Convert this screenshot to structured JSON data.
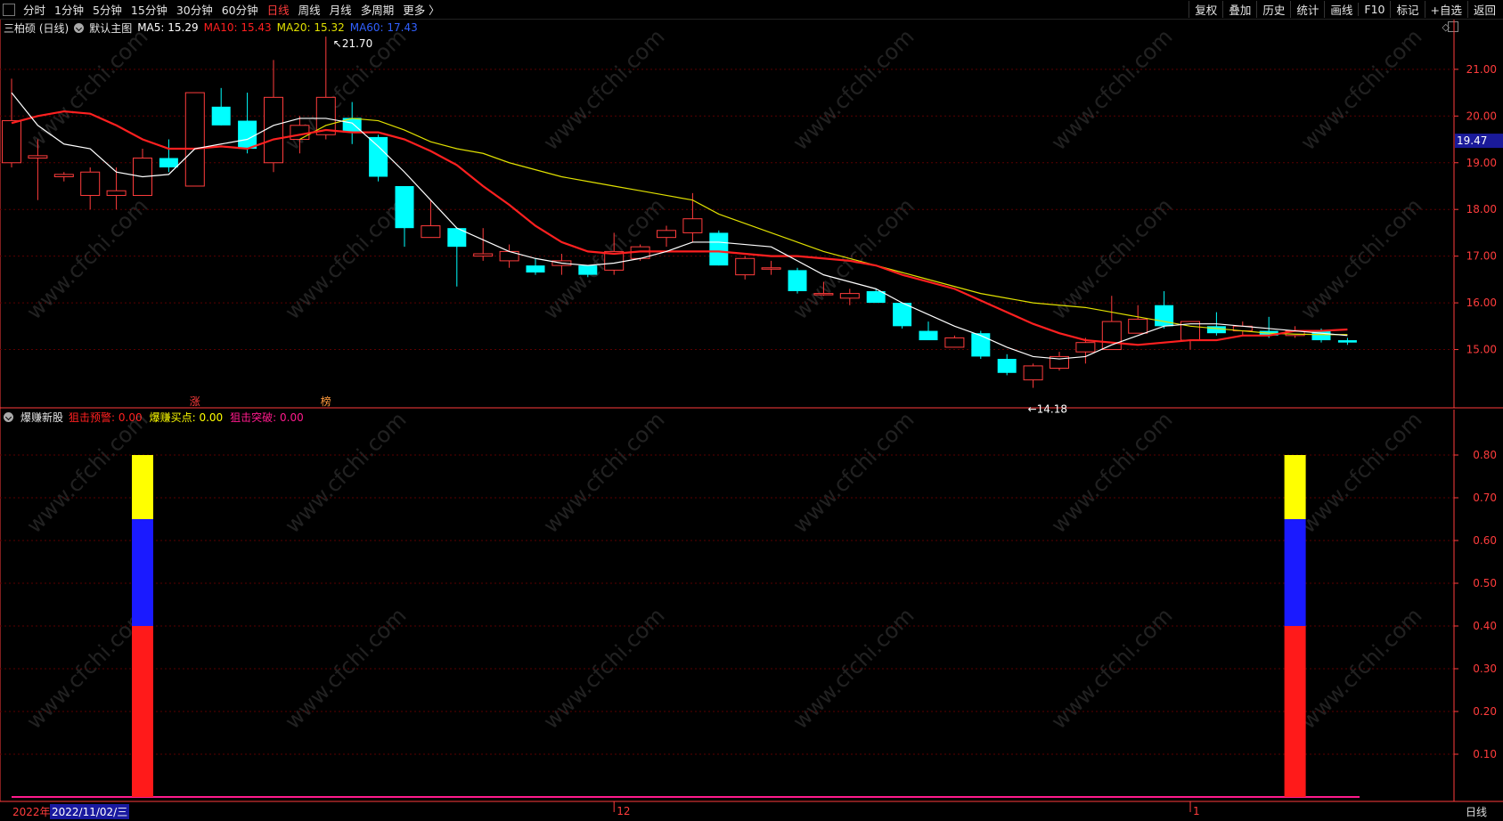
{
  "toolbar": {
    "periods": [
      "分时",
      "1分钟",
      "5分钟",
      "15分钟",
      "30分钟",
      "60分钟",
      "日线",
      "周线",
      "月线",
      "多周期",
      "更多 〉"
    ],
    "active_period": "日线",
    "actions": [
      "复权",
      "叠加",
      "历史",
      "统计",
      "画线",
      "F10",
      "标记",
      "+自选",
      "返回"
    ]
  },
  "legend": {
    "stock": "三柏硕 (日线)",
    "main_chart": "默认主图",
    "ma5": "MA5: 15.29",
    "ma10": "MA10: 15.43",
    "ma20": "MA20: 15.32",
    "ma60": "MA60: 17.43"
  },
  "indicator_legend": {
    "name": "爆赚新股",
    "a": "狙击预警: 0.00",
    "b": "爆赚买点: 0.00",
    "c": "狙击突破: 0.00"
  },
  "colors": {
    "up": "#ff3c3c",
    "down": "#00ffff",
    "ma5": "#ffffff",
    "ma10": "#ff2020",
    "ma20": "#e0e000",
    "ma60": "#3060ff",
    "grid": "#5a0000",
    "axis": "#ff3c3c"
  },
  "chart_data": [
    {
      "type": "candlestick",
      "title": "三柏硕 (日线)",
      "ylim": [
        14.0,
        21.7
      ],
      "yticks": [
        15.0,
        16.0,
        17.0,
        18.0,
        19.0,
        20.0,
        21.0
      ],
      "ytick_labels": [
        "15.00",
        "16.00",
        "17.00",
        "18.00",
        "19.00",
        "20.00",
        "21.00"
      ],
      "current_price_tag": "19.47",
      "high_annotation": "21.70",
      "low_annotation": "14.18",
      "markers": [
        {
          "text": "涨",
          "index": 7
        },
        {
          "text": "榜",
          "index": 12
        }
      ],
      "candles": [
        {
          "o": 19.0,
          "h": 20.8,
          "l": 18.9,
          "c": 19.9
        },
        {
          "o": 19.1,
          "h": 19.5,
          "l": 18.2,
          "c": 19.15
        },
        {
          "o": 18.7,
          "h": 18.8,
          "l": 18.6,
          "c": 18.75
        },
        {
          "o": 18.3,
          "h": 18.9,
          "l": 18.0,
          "c": 18.8
        },
        {
          "o": 18.3,
          "h": 18.9,
          "l": 18.0,
          "c": 18.4
        },
        {
          "o": 18.3,
          "h": 19.3,
          "l": 18.3,
          "c": 19.1
        },
        {
          "o": 19.1,
          "h": 19.5,
          "l": 18.8,
          "c": 18.9
        },
        {
          "o": 18.5,
          "h": 20.5,
          "l": 18.5,
          "c": 20.5
        },
        {
          "o": 20.2,
          "h": 20.6,
          "l": 19.8,
          "c": 19.8
        },
        {
          "o": 19.9,
          "h": 20.5,
          "l": 19.2,
          "c": 19.3
        },
        {
          "o": 19.0,
          "h": 21.2,
          "l": 18.8,
          "c": 20.4
        },
        {
          "o": 19.5,
          "h": 20.0,
          "l": 19.2,
          "c": 19.8
        },
        {
          "o": 19.6,
          "h": 21.7,
          "l": 19.5,
          "c": 20.4
        },
        {
          "o": 19.96,
          "h": 20.3,
          "l": 19.4,
          "c": 19.65
        },
        {
          "o": 19.55,
          "h": 19.6,
          "l": 18.6,
          "c": 18.7
        },
        {
          "o": 18.5,
          "h": 18.5,
          "l": 17.2,
          "c": 17.6
        },
        {
          "o": 17.4,
          "h": 18.2,
          "l": 17.4,
          "c": 17.65
        },
        {
          "o": 17.6,
          "h": 17.6,
          "l": 16.35,
          "c": 17.2
        },
        {
          "o": 17.0,
          "h": 17.6,
          "l": 16.9,
          "c": 17.05
        },
        {
          "o": 16.9,
          "h": 17.25,
          "l": 16.75,
          "c": 17.1
        },
        {
          "o": 16.8,
          "h": 16.95,
          "l": 16.6,
          "c": 16.65
        },
        {
          "o": 16.8,
          "h": 17.05,
          "l": 16.6,
          "c": 16.9
        },
        {
          "o": 16.8,
          "h": 16.8,
          "l": 16.55,
          "c": 16.6
        },
        {
          "o": 16.7,
          "h": 17.5,
          "l": 16.6,
          "c": 17.1
        },
        {
          "o": 16.95,
          "h": 17.25,
          "l": 16.9,
          "c": 17.2
        },
        {
          "o": 17.4,
          "h": 17.65,
          "l": 17.2,
          "c": 17.55
        },
        {
          "o": 17.5,
          "h": 18.35,
          "l": 17.3,
          "c": 17.8
        },
        {
          "o": 17.5,
          "h": 17.55,
          "l": 16.8,
          "c": 16.8
        },
        {
          "o": 16.6,
          "h": 17.0,
          "l": 16.5,
          "c": 16.95
        },
        {
          "o": 16.75,
          "h": 16.9,
          "l": 16.6,
          "c": 16.75
        },
        {
          "o": 16.7,
          "h": 16.75,
          "l": 16.2,
          "c": 16.25
        },
        {
          "o": 16.2,
          "h": 16.45,
          "l": 16.15,
          "c": 16.2
        },
        {
          "o": 16.1,
          "h": 16.3,
          "l": 15.95,
          "c": 16.2
        },
        {
          "o": 16.25,
          "h": 16.3,
          "l": 16.0,
          "c": 16.0
        },
        {
          "o": 16.0,
          "h": 16.0,
          "l": 15.45,
          "c": 15.5
        },
        {
          "o": 15.4,
          "h": 15.6,
          "l": 15.2,
          "c": 15.2
        },
        {
          "o": 15.05,
          "h": 15.3,
          "l": 15.05,
          "c": 15.25
        },
        {
          "o": 15.35,
          "h": 15.4,
          "l": 14.8,
          "c": 14.85
        },
        {
          "o": 14.8,
          "h": 14.9,
          "l": 14.45,
          "c": 14.5
        },
        {
          "o": 14.35,
          "h": 14.7,
          "l": 14.18,
          "c": 14.65
        },
        {
          "o": 14.6,
          "h": 14.95,
          "l": 14.55,
          "c": 14.85
        },
        {
          "o": 14.95,
          "h": 15.25,
          "l": 14.7,
          "c": 15.15
        },
        {
          "o": 15.0,
          "h": 16.15,
          "l": 15.0,
          "c": 15.6
        },
        {
          "o": 15.35,
          "h": 15.95,
          "l": 15.35,
          "c": 15.65
        },
        {
          "o": 15.95,
          "h": 16.25,
          "l": 15.45,
          "c": 15.5
        },
        {
          "o": 15.2,
          "h": 15.4,
          "l": 15.0,
          "c": 15.6
        },
        {
          "o": 15.5,
          "h": 15.8,
          "l": 15.3,
          "c": 15.35
        },
        {
          "o": 15.4,
          "h": 15.6,
          "l": 15.3,
          "c": 15.5
        },
        {
          "o": 15.4,
          "h": 15.7,
          "l": 15.25,
          "c": 15.3
        },
        {
          "o": 15.3,
          "h": 15.5,
          "l": 15.25,
          "c": 15.4
        },
        {
          "o": 15.4,
          "h": 15.45,
          "l": 15.15,
          "c": 15.2
        },
        {
          "o": 15.2,
          "h": 15.25,
          "l": 15.1,
          "c": 15.15
        }
      ],
      "ma5": [
        20.5,
        19.8,
        19.4,
        19.3,
        18.8,
        18.7,
        18.75,
        19.3,
        19.4,
        19.5,
        19.8,
        19.95,
        19.95,
        19.85,
        19.35,
        18.8,
        18.2,
        17.6,
        17.35,
        17.1,
        16.95,
        16.85,
        16.8,
        16.85,
        16.95,
        17.1,
        17.3,
        17.3,
        17.25,
        17.2,
        16.9,
        16.6,
        16.45,
        16.3,
        16.0,
        15.75,
        15.5,
        15.3,
        15.05,
        14.85,
        14.8,
        14.85,
        15.1,
        15.3,
        15.5,
        15.55,
        15.55,
        15.5,
        15.45,
        15.4,
        15.35,
        15.3
      ],
      "ma10": [
        19.85,
        20.0,
        20.1,
        20.05,
        19.8,
        19.5,
        19.3,
        19.3,
        19.35,
        19.3,
        19.5,
        19.6,
        19.7,
        19.65,
        19.65,
        19.5,
        19.25,
        18.95,
        18.5,
        18.1,
        17.65,
        17.3,
        17.1,
        17.05,
        17.1,
        17.1,
        17.1,
        17.1,
        17.05,
        17.0,
        17.0,
        16.95,
        16.9,
        16.8,
        16.6,
        16.45,
        16.3,
        16.05,
        15.8,
        15.55,
        15.35,
        15.2,
        15.15,
        15.1,
        15.15,
        15.2,
        15.2,
        15.3,
        15.3,
        15.4,
        15.4,
        15.43
      ],
      "ma20": [
        null,
        null,
        null,
        null,
        null,
        null,
        null,
        null,
        null,
        null,
        null,
        19.5,
        19.8,
        19.95,
        19.9,
        19.7,
        19.45,
        19.3,
        19.2,
        19.0,
        18.85,
        18.7,
        18.6,
        18.5,
        18.4,
        18.3,
        18.2,
        17.9,
        17.7,
        17.5,
        17.3,
        17.1,
        16.95,
        16.8,
        16.65,
        16.5,
        16.35,
        16.2,
        16.1,
        16.0,
        15.95,
        15.9,
        15.8,
        15.7,
        15.6,
        15.5,
        15.45,
        15.4,
        15.35,
        15.33,
        15.32,
        15.32
      ]
    },
    {
      "type": "bar",
      "title": "爆赚新股",
      "ylim": [
        0,
        0.8
      ],
      "yticks": [
        0.1,
        0.2,
        0.3,
        0.4,
        0.5,
        0.6,
        0.7,
        0.8
      ],
      "ytick_labels": [
        "0.10",
        "0.20",
        "0.30",
        "0.40",
        "0.50",
        "0.60",
        "0.70",
        "0.80"
      ],
      "signals": [
        {
          "index": 5,
          "segments": [
            {
              "from": 0,
              "to": 0.4,
              "color": "#ff1a1a"
            },
            {
              "from": 0.4,
              "to": 0.65,
              "color": "#1a1aff"
            },
            {
              "from": 0.65,
              "to": 0.8,
              "color": "#ffff00"
            }
          ]
        },
        {
          "index": 49,
          "segments": [
            {
              "from": 0,
              "to": 0.4,
              "color": "#ff1a1a"
            },
            {
              "from": 0.4,
              "to": 0.65,
              "color": "#1a1aff"
            },
            {
              "from": 0.65,
              "to": 0.8,
              "color": "#ffff00"
            }
          ]
        }
      ]
    }
  ],
  "xaxis": {
    "year_label": "2022年",
    "cursor_date": "2022/11/02/三",
    "month_labels": [
      {
        "text": "12",
        "index": 23
      },
      {
        "text": "1",
        "index": 45
      }
    ]
  },
  "period_label": "日线",
  "watermark": "www.cfchi.com"
}
